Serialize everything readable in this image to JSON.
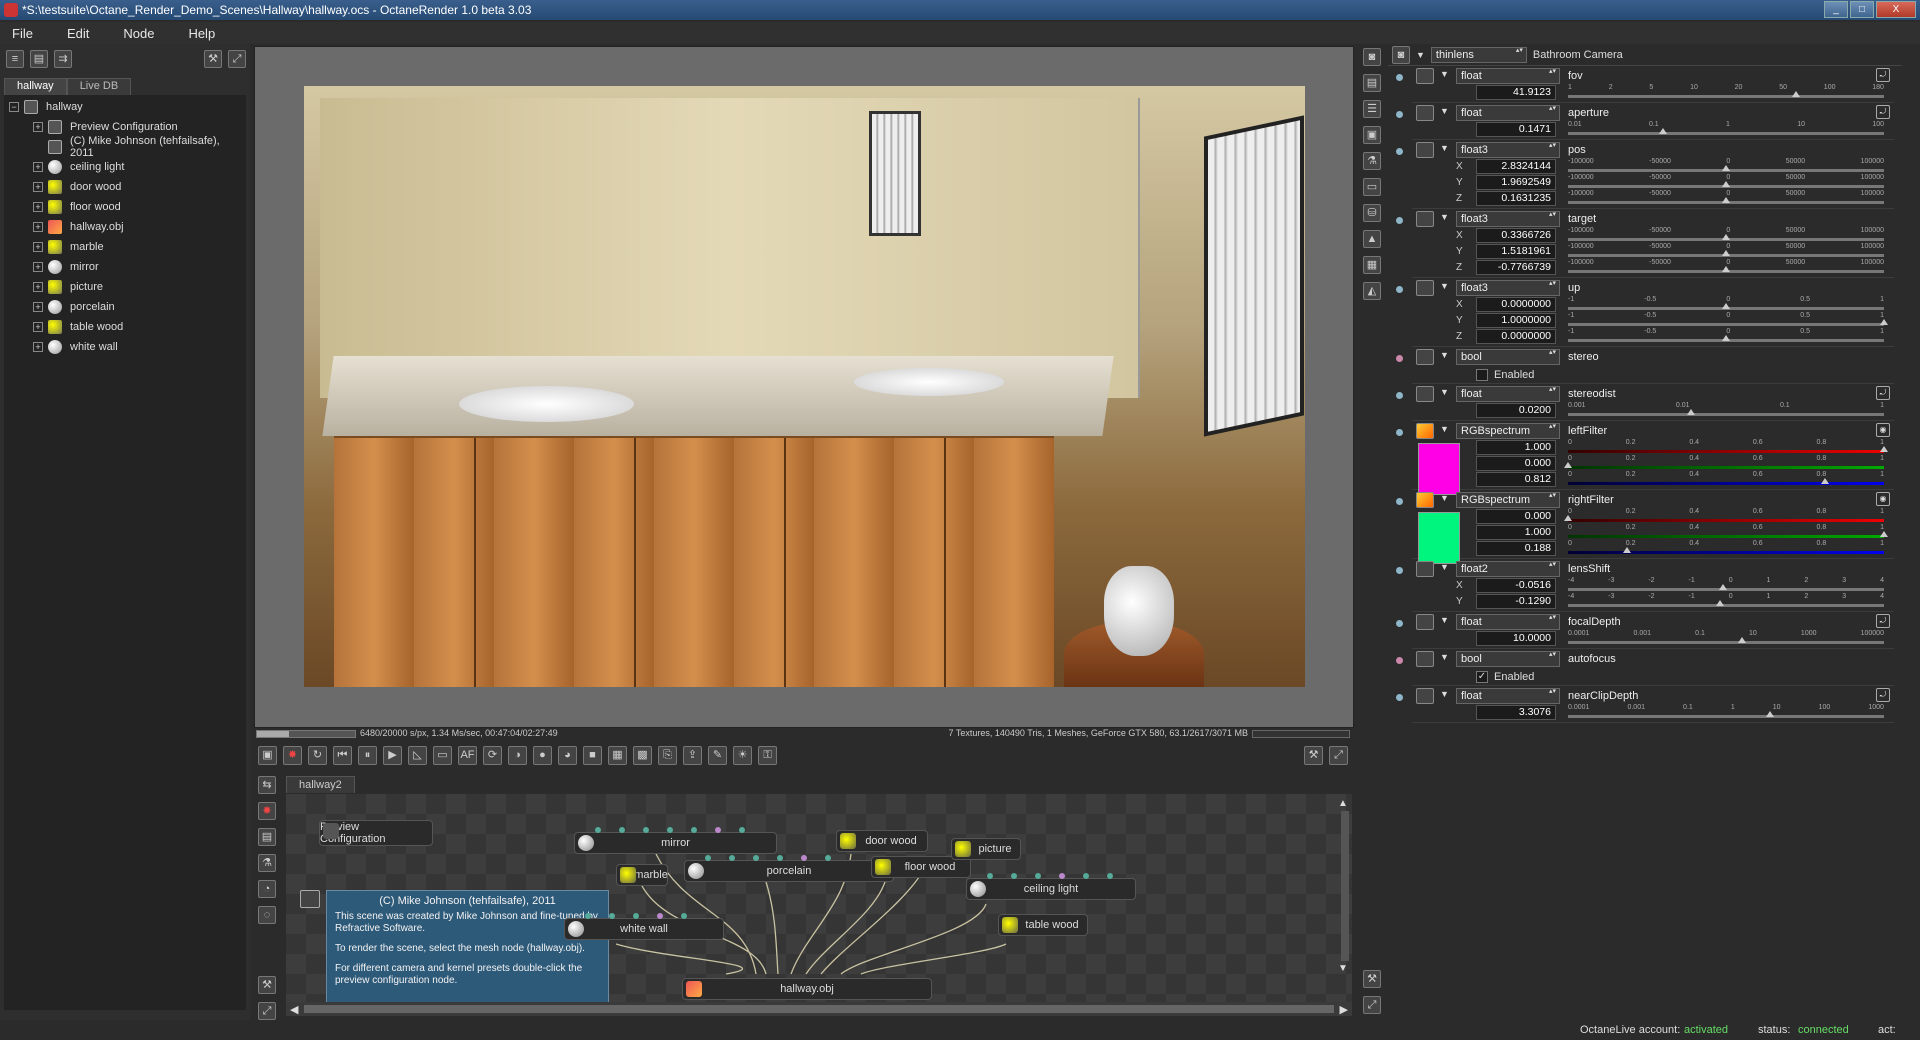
{
  "window": {
    "title": "*S:\\testsuite\\Octane_Render_Demo_Scenes\\Hallway\\hallway.ocs - OctaneRender 1.0 beta 3.03",
    "min": "_",
    "max": "□",
    "close": "X"
  },
  "menu": [
    "File",
    "Edit",
    "Node",
    "Help"
  ],
  "left": {
    "tabs": [
      "hallway",
      "Live DB"
    ],
    "root": "hallway",
    "items": [
      {
        "label": "Preview Configuration",
        "icon": "config-icon",
        "expand": "+"
      },
      {
        "label": "(C) Mike Johnson (tehfailsafe), 2011",
        "icon": "comment-icon",
        "expand": ""
      },
      {
        "label": "ceiling light",
        "icon": "material-sphere-icon",
        "expand": "+"
      },
      {
        "label": "door wood",
        "icon": "texture-material-icon",
        "expand": "+"
      },
      {
        "label": "floor wood",
        "icon": "texture-material-icon",
        "expand": "+"
      },
      {
        "label": "hallway.obj",
        "icon": "mesh-icon",
        "expand": "+"
      },
      {
        "label": "marble",
        "icon": "texture-material-icon",
        "expand": "+"
      },
      {
        "label": "mirror",
        "icon": "material-sphere-icon",
        "expand": "+"
      },
      {
        "label": "picture",
        "icon": "texture-material-icon",
        "expand": "+"
      },
      {
        "label": "porcelain",
        "icon": "material-sphere-icon",
        "expand": "+"
      },
      {
        "label": "table wood",
        "icon": "texture-material-icon",
        "expand": "+"
      },
      {
        "label": "white wall",
        "icon": "material-sphere-icon",
        "expand": "+"
      }
    ]
  },
  "render": {
    "progress": 0.324,
    "stats": "6480/20000 s/px, 1.34 Ms/sec, 00:47:04/02:27:49",
    "scene_stats": "7 Textures, 140490 Tris, 1 Meshes, GeForce GTX 580, 63.1/2617/3071 MB"
  },
  "node_editor": {
    "tab": "hallway2",
    "preview_node": "Preview Configuration",
    "comment": {
      "title": "(C) Mike Johnson (tehfailsafe), 2011",
      "p1": "This scene was created by Mike Johnson and fine-tuned by Refractive Software.",
      "p2": "To render the scene, select the mesh node (hallway.obj).",
      "p3": "For different camera and kernel presets double-click the preview configuration node."
    },
    "nodes": {
      "mirror": "mirror",
      "marble": "marble",
      "porcelain": "porcelain",
      "door_wood": "door wood",
      "floor_wood": "floor wood",
      "picture": "picture",
      "ceiling_light": "ceiling light",
      "white_wall": "white wall",
      "table_wood": "table wood",
      "hallway_obj": "hallway.obj"
    }
  },
  "camera": {
    "type": "thinlens",
    "name": "Bathroom Camera",
    "params": {
      "fov": {
        "type": "float",
        "name": "fov",
        "value": "41.9123",
        "ticks": [
          "1",
          "2",
          "5",
          "10",
          "20",
          "50",
          "100",
          "180"
        ]
      },
      "aperture": {
        "type": "float",
        "name": "aperture",
        "value": "0.1471",
        "ticks": [
          "0.01",
          "0.1",
          "1",
          "10",
          "100"
        ]
      },
      "pos": {
        "type": "float3",
        "name": "pos",
        "x": "2.8324144",
        "y": "1.9692549",
        "z": "0.1631235",
        "ticks": [
          "-100000",
          "-50000",
          "0",
          "50000",
          "100000"
        ]
      },
      "target": {
        "type": "float3",
        "name": "target",
        "x": "0.3366726",
        "y": "1.5181961",
        "z": "-0.7766739",
        "ticks": [
          "-100000",
          "-50000",
          "0",
          "50000",
          "100000"
        ]
      },
      "up": {
        "type": "float3",
        "name": "up",
        "x": "0.0000000",
        "y": "1.0000000",
        "z": "0.0000000",
        "ticks": [
          "-1",
          "-0.5",
          "0",
          "0.5",
          "1"
        ]
      },
      "stereo": {
        "type": "bool",
        "name": "stereo",
        "label": "Enabled",
        "checked": ""
      },
      "stereodist": {
        "type": "float",
        "name": "stereodist",
        "value": "0.0200",
        "ticks": [
          "0.001",
          "0.01",
          "0.1",
          "1"
        ]
      },
      "leftFilter": {
        "type": "RGBspectrum",
        "name": "leftFilter",
        "r": "1.000",
        "g": "0.000",
        "b": "0.812",
        "color": "#ff00e6",
        "ticks": [
          "0",
          "0.2",
          "0.4",
          "0.6",
          "0.8",
          "1"
        ]
      },
      "rightFilter": {
        "type": "RGBspectrum",
        "name": "rightFilter",
        "r": "0.000",
        "g": "1.000",
        "b": "0.188",
        "color": "#00f57f",
        "ticks": [
          "0",
          "0.2",
          "0.4",
          "0.6",
          "0.8",
          "1"
        ]
      },
      "lensShift": {
        "type": "float2",
        "name": "lensShift",
        "x": "-0.0516",
        "y": "-0.1290",
        "ticks": [
          "-4",
          "-3",
          "-2",
          "-1",
          "0",
          "1",
          "2",
          "3",
          "4"
        ]
      },
      "focalDepth": {
        "type": "float",
        "name": "focalDepth",
        "value": "10.0000",
        "ticks": [
          "0.0001",
          "0.001",
          "0.1",
          "10",
          "1000",
          "100000"
        ]
      },
      "autofocus": {
        "type": "bool",
        "name": "autofocus",
        "label": "Enabled",
        "checked": "✓"
      },
      "nearClipDepth": {
        "type": "float",
        "name": "nearClipDepth",
        "value": "3.3076",
        "ticks": [
          "0.0001",
          "0.001",
          "0.1",
          "1",
          "10",
          "100",
          "1000"
        ]
      }
    }
  },
  "footer": {
    "account_label": "OctaneLive account:",
    "account_value": "activated",
    "status_label": "status:",
    "status_value": "connected",
    "act_label": "act:"
  }
}
